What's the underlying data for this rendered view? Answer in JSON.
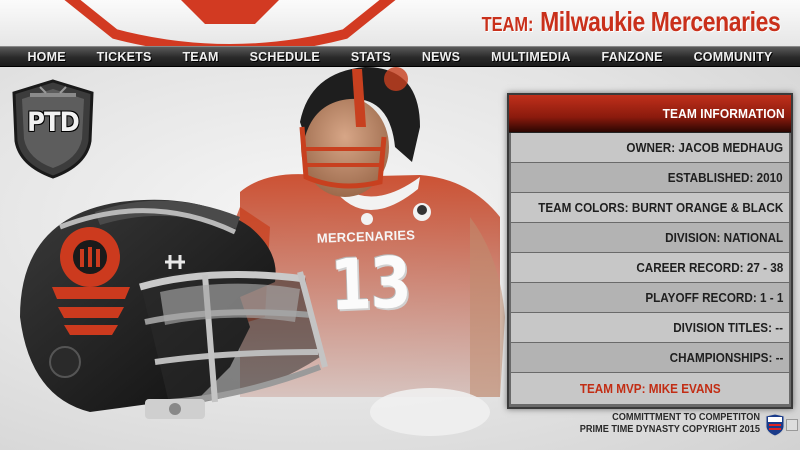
{
  "header": {
    "team_label": "TEAM:",
    "team_name": "Milwaukie Mercenaries"
  },
  "nav": {
    "items": [
      "HOME",
      "TICKETS",
      "TEAM",
      "SCHEDULE",
      "STATS",
      "NEWS",
      "MULTIMEDIA",
      "FANZONE",
      "COMMUNITY"
    ]
  },
  "badge": {
    "text": "PTD",
    "icon": "shield-badge-icon"
  },
  "jersey": {
    "wordmark": "MERCENARIES",
    "number": "13"
  },
  "team_info": {
    "title": "TEAM INFORMATION",
    "rows": [
      "OWNER:  JACOB MEDHAUG",
      "ESTABLISHED: 2010",
      "TEAM COLORS: BURNT ORANGE & BLACK",
      "DIVISION: NATIONAL",
      "CAREER RECORD: 27 - 38",
      "PLAYOFF RECORD: 1 - 1",
      "DIVISION TITLES: --",
      "CHAMPIONSHIPS: --"
    ],
    "mvp": "TEAM MVP: MIKE EVANS"
  },
  "footer": {
    "line1": "COMMITTMENT TO COMPETITON",
    "line2": "PRIME TIME DYNASTY COPYRIGHT 2015"
  },
  "colors": {
    "accent": "#c9301b",
    "nav_bg": "#2a2a2a",
    "panel_header": "#8a1a0d",
    "panel_row_light": "#c7c7c7",
    "panel_row_dark": "#b3b3b3"
  }
}
